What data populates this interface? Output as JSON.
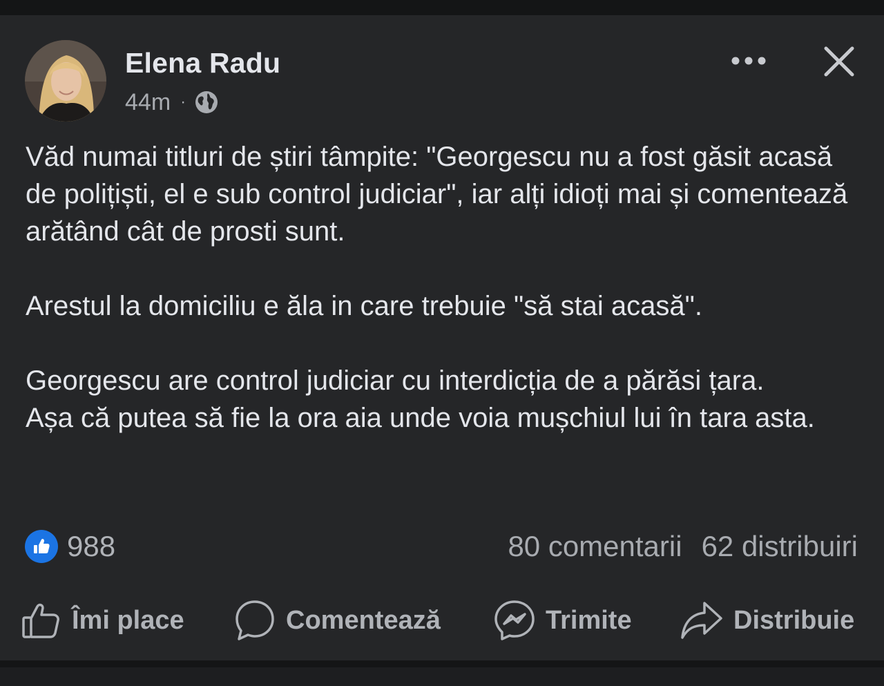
{
  "post": {
    "author": "Elena Radu",
    "time": "44m",
    "separator": "·",
    "audience_icon": "globe-icon",
    "paragraphs": [
      "Văd numai titluri de știri tâmpite: \"Georgescu nu a fost găsit acasă de polițiști, el e sub control judiciar\", iar alți idioți mai și comentează arătând cât de prosti sunt.",
      "Arestul la domiciliu e ăla in care trebuie \"să stai acasă\".",
      "Georgescu are control judiciar cu interdicția de a părăsi țara.",
      "Așa că putea să fie la ora aia unde voia mușchiul lui în tara asta."
    ]
  },
  "header_icons": {
    "more": "more-horizontal-icon",
    "close": "close-icon"
  },
  "engagement": {
    "reaction_icon": "like-reaction-icon",
    "reaction_count": "988",
    "comments": "80 comentarii",
    "shares": "62 distribuiri"
  },
  "actions": {
    "like": "Îmi place",
    "comment": "Comentează",
    "send": "Trimite",
    "share": "Distribuie"
  },
  "colors": {
    "background": "#252628",
    "text": "#e4e6eb",
    "muted": "#b0b3b8",
    "accent": "#1b74e4"
  }
}
